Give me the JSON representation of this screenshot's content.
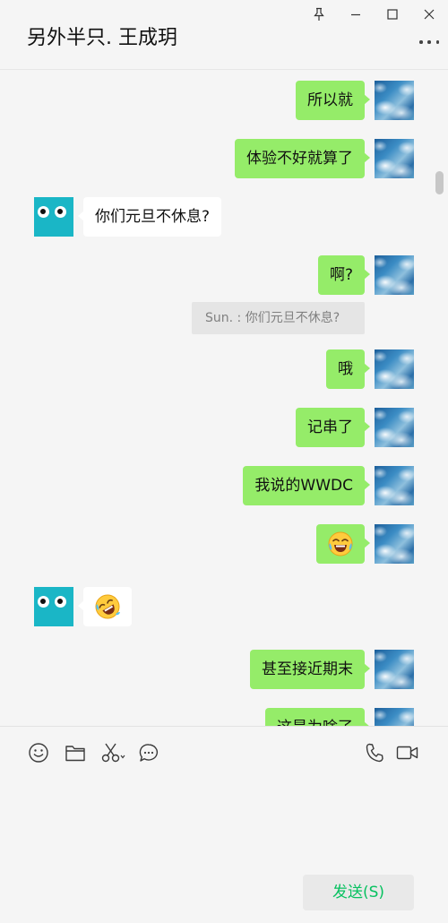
{
  "window": {
    "title": "另外半只. 王成玥"
  },
  "messages": [
    {
      "side": "out",
      "text": "所以就"
    },
    {
      "side": "out",
      "text": "体验不好就算了"
    },
    {
      "side": "in",
      "text": "你们元旦不休息?"
    },
    {
      "side": "out",
      "text": "啊?"
    },
    {
      "side": "out",
      "text": "哦"
    },
    {
      "side": "out",
      "text": "记串了"
    },
    {
      "side": "out",
      "text": "我说的WWDC"
    },
    {
      "side": "out",
      "emoji": "laughing-crying-emoji"
    },
    {
      "side": "in",
      "emoji": "rolling-laughing-emoji"
    },
    {
      "side": "out",
      "text": "甚至接近期末"
    },
    {
      "side": "out",
      "text": "这是为啥了"
    }
  ],
  "quote": {
    "text": "Sun. : 你们元旦不休息?"
  },
  "toolbar": {
    "icons": [
      "emoji-icon",
      "folder-icon",
      "scissors-icon",
      "chat-bubble-icon",
      "phone-icon",
      "video-camera-icon"
    ]
  },
  "composer": {
    "send_label": "发送(S)"
  },
  "colors": {
    "outgoing_bubble": "#95ec69",
    "incoming_bubble": "#ffffff",
    "background": "#f5f5f5",
    "send_text": "#07c160"
  }
}
